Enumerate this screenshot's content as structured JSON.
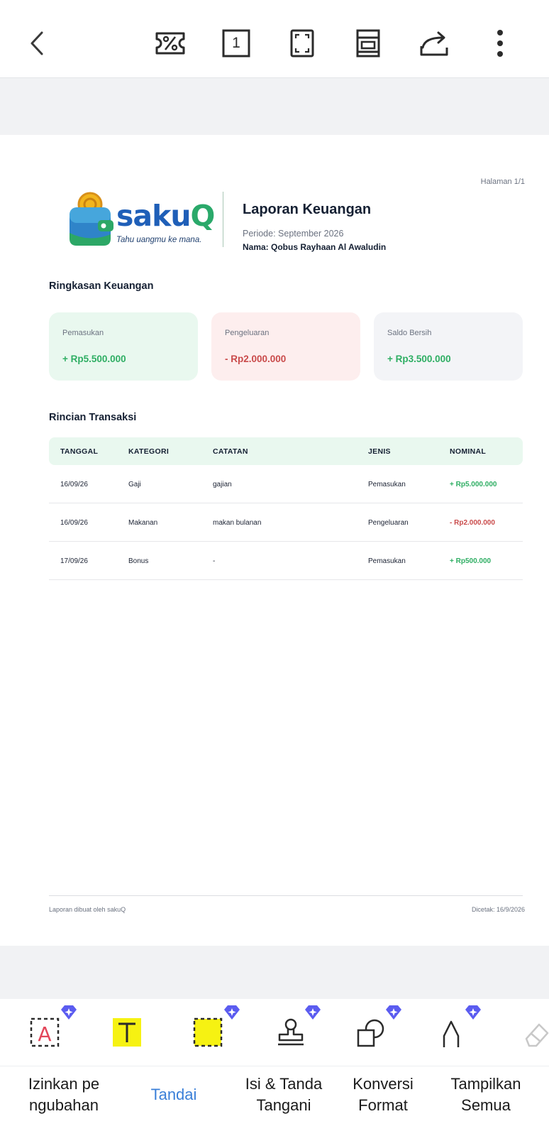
{
  "topbar": {
    "back_icon": "chevron-left-icon",
    "icons": [
      "percent-ticket-icon",
      "page-number-icon",
      "fullscreen-icon",
      "layout-icon",
      "share-icon",
      "more-vertical-icon"
    ],
    "page_number_label": "1"
  },
  "document": {
    "page_indicator": "Halaman 1/1",
    "logo": {
      "wordmark": "sakuQ",
      "tagline": "Tahu uangmu ke mana."
    },
    "title": "Laporan Keuangan",
    "period": "Periode: September 2026",
    "name": "Nama: Qobus Rayhaan Al Awaludin",
    "summary_title": "Ringkasan Keuangan",
    "cards": [
      {
        "label": "Pemasukan",
        "value": "+ Rp5.500.000",
        "bg": "#e9f8ef",
        "color": "#2eae63"
      },
      {
        "label": "Pengeluaran",
        "value": "- Rp2.000.000",
        "bg": "#fdeeee",
        "color": "#c94a4a"
      },
      {
        "label": "Saldo Bersih",
        "value": "+ Rp3.500.000",
        "bg": "#f3f4f7",
        "color": "#2eae63"
      }
    ],
    "transactions_title": "Rincian Transaksi",
    "table": {
      "headers": [
        "TANGGAL",
        "KATEGORI",
        "CATATAN",
        "JENIS",
        "NOMINAL"
      ],
      "rows": [
        {
          "date": "16/09/26",
          "category": "Gaji",
          "note": "gajian",
          "type": "Pemasukan",
          "amount": "+ Rp5.000.000",
          "color": "#2eae63"
        },
        {
          "date": "16/09/26",
          "category": "Makanan",
          "note": "makan bulanan",
          "type": "Pengeluaran",
          "amount": "- Rp2.000.000",
          "color": "#c94a4a"
        },
        {
          "date": "17/09/26",
          "category": "Bonus",
          "note": "-",
          "type": "Pemasukan",
          "amount": "+ Rp500.000",
          "color": "#2eae63"
        }
      ]
    },
    "footer_left": "Laporan dibuat oleh sakuQ",
    "footer_right": "Dicetak: 16/9/2026"
  },
  "bottom_toolbar": {
    "tool_icons": [
      "text-box-icon",
      "highlight-text-icon",
      "highlight-area-icon",
      "stamp-icon",
      "shapes-icon",
      "pen-icon",
      "eraser-icon"
    ],
    "tabs": [
      {
        "label_line1": "Izinkan pe",
        "label_line2": "ngubahan"
      },
      {
        "label_line1": "Tandai",
        "label_line2": ""
      },
      {
        "label_line1": "Isi & Tanda",
        "label_line2": "Tangani"
      },
      {
        "label_line1": "Konversi",
        "label_line2": "Format"
      },
      {
        "label_line1": "Tampilkan",
        "label_line2": "Semua"
      }
    ],
    "colors": {
      "active": "#3a7fd8",
      "premium_gem": "#5b5cf0",
      "highlight": "#f6f212"
    }
  }
}
